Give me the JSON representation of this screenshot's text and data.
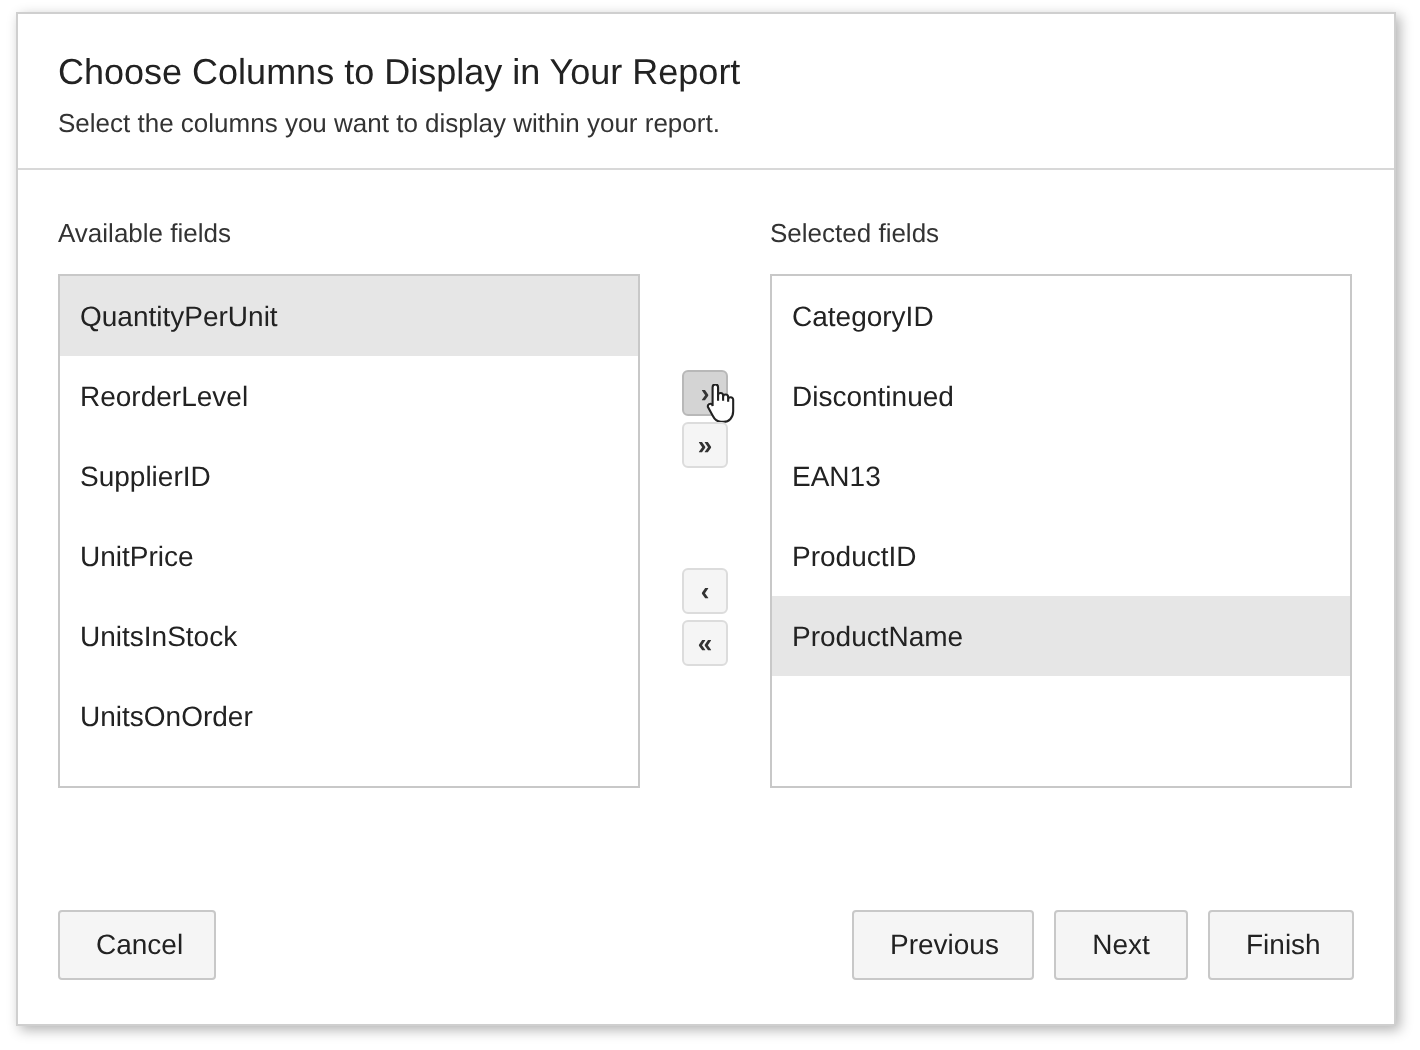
{
  "dialog": {
    "title": "Choose Columns to Display in Your Report",
    "subtitle": "Select the columns you want to display within your report."
  },
  "available": {
    "label": "Available fields",
    "items": [
      {
        "label": "QuantityPerUnit",
        "selected": true
      },
      {
        "label": "ReorderLevel",
        "selected": false
      },
      {
        "label": "SupplierID",
        "selected": false
      },
      {
        "label": "UnitPrice",
        "selected": false
      },
      {
        "label": "UnitsInStock",
        "selected": false
      },
      {
        "label": "UnitsOnOrder",
        "selected": false
      }
    ]
  },
  "move_buttons": [
    [
      {
        "label": "›",
        "hovered": true
      },
      {
        "label": "»",
        "hovered": false
      }
    ],
    [
      {
        "label": "‹",
        "hovered": false
      },
      {
        "label": "«",
        "hovered": false
      }
    ]
  ],
  "selected": {
    "label": "Selected fields",
    "items": [
      {
        "label": "CategoryID",
        "selected": false
      },
      {
        "label": "Discontinued",
        "selected": false
      },
      {
        "label": "EAN13",
        "selected": false
      },
      {
        "label": "ProductID",
        "selected": false
      },
      {
        "label": "ProductName",
        "selected": true
      }
    ]
  },
  "buttons": {
    "cancel": "Cancel",
    "previous": "Previous",
    "next": "Next",
    "finish": "Finish"
  }
}
